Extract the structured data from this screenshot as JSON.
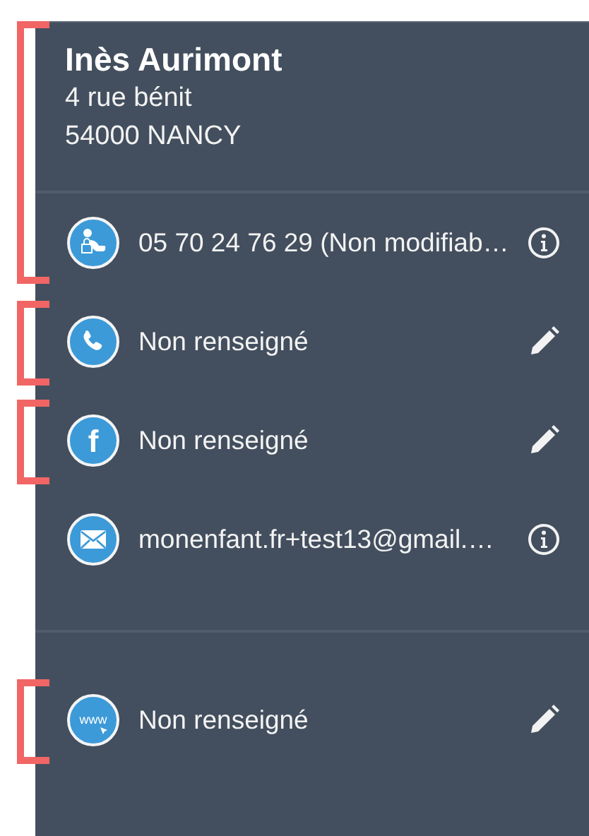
{
  "blocks": [
    {
      "bracketed": true,
      "contact": {
        "name": "Inès Aurimont",
        "address_lines": [
          "4 rue bénit",
          "54000 NANCY"
        ]
      },
      "rows": [
        {
          "kind": "landline",
          "text": "05 70 24 76 29 (Non modifiab…",
          "action": {
            "kind": "info"
          }
        }
      ]
    },
    {
      "bracketed": true,
      "rows": [
        {
          "kind": "phone",
          "text": "Non renseigné",
          "action": {
            "kind": "edit"
          }
        }
      ]
    },
    {
      "bracketed": true,
      "rows": [
        {
          "kind": "social",
          "icon_text": "f",
          "text": "Non renseigné",
          "action": {
            "kind": "edit"
          }
        }
      ]
    },
    {
      "bracketed": false,
      "rows": [
        {
          "kind": "email",
          "text": "monenfant.fr+test13@gmail.…",
          "action": {
            "kind": "info"
          }
        }
      ]
    },
    {
      "bracketed": true,
      "divider_before": true,
      "rows": [
        {
          "kind": "website",
          "icon_text": "www",
          "text": "Non renseigné",
          "action": {
            "kind": "edit"
          }
        }
      ]
    }
  ]
}
